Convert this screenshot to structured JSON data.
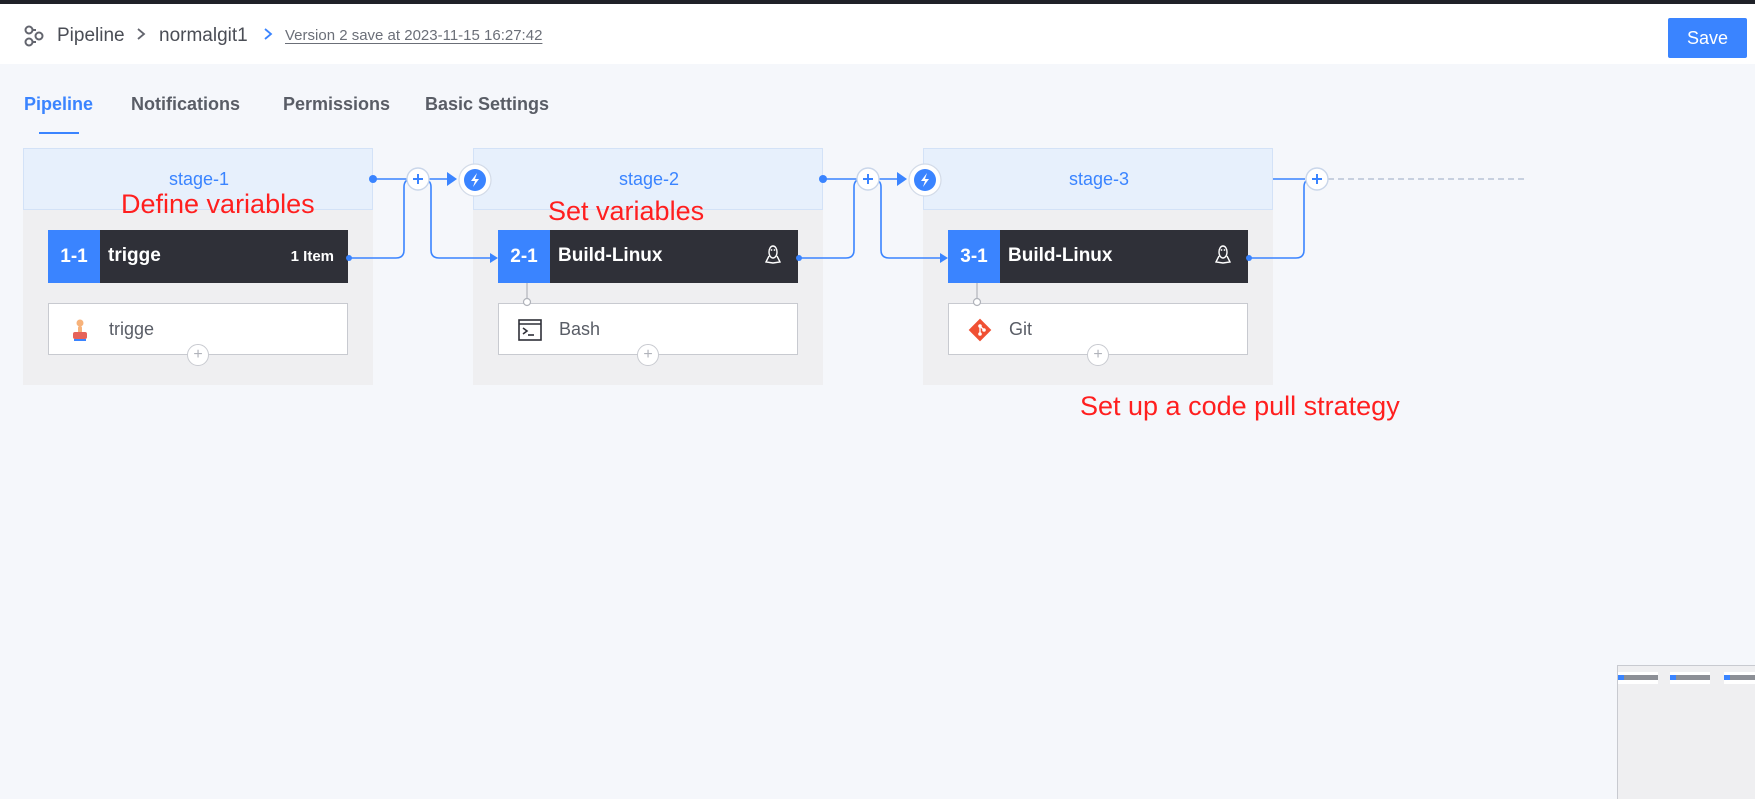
{
  "breadcrumb": {
    "root": "Pipeline",
    "pipeline_name": "normalgit1",
    "version": "Version 2 save at 2023-11-15 16:27:42"
  },
  "header": {
    "save_label": "Save"
  },
  "tabs": [
    {
      "label": "Pipeline",
      "active": true
    },
    {
      "label": "Notifications",
      "active": false
    },
    {
      "label": "Permissions",
      "active": false
    },
    {
      "label": "Basic Settings",
      "active": false
    }
  ],
  "stages": [
    {
      "title": "stage-1",
      "job": {
        "index": "1-1",
        "name": "trigge",
        "count": "1 Item"
      },
      "step": {
        "name": "trigge",
        "icon": "manual-trigger-icon"
      }
    },
    {
      "title": "stage-2",
      "job": {
        "index": "2-1",
        "name": "Build-Linux",
        "os_icon": "linux-icon"
      },
      "step": {
        "name": "Bash",
        "icon": "terminal-icon"
      }
    },
    {
      "title": "stage-3",
      "job": {
        "index": "3-1",
        "name": "Build-Linux",
        "os_icon": "linux-icon"
      },
      "step": {
        "name": "Git",
        "icon": "git-icon"
      }
    }
  ],
  "annotations": {
    "define_variables": "Define variables",
    "set_variables": "Set variables",
    "code_pull": "Set up a code pull strategy"
  },
  "colors": {
    "accent": "#3a84ff",
    "job_bar": "#2f3038",
    "annotation": "#ff1f1f",
    "git": "#f05033"
  }
}
